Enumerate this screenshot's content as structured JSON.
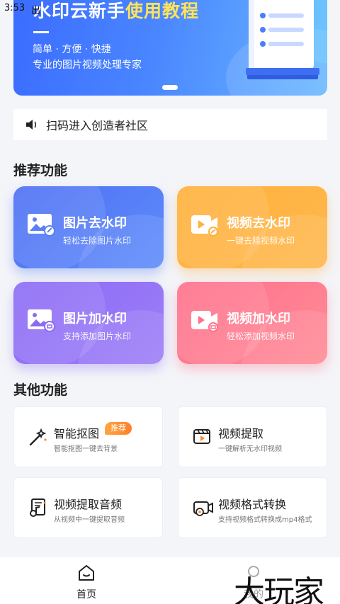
{
  "status_bar": {
    "time": "3:53",
    "extra": "出"
  },
  "banner": {
    "title_prefix": "水印云新手",
    "title_highlight": "使用教程",
    "subtitle1": "简单 · 方便 · 快捷",
    "subtitle2": "专业的图片视频处理专家"
  },
  "notice": {
    "text": "扫码进入创造者社区",
    "icon": "speaker-icon"
  },
  "recommended": {
    "title": "推荐功能",
    "items": [
      {
        "title": "图片去水印",
        "subtitle": "轻松去除图片水印",
        "icon": "image-remove-icon",
        "color": "#4d6ff3"
      },
      {
        "title": "视频去水印",
        "subtitle": "一键去除视频水印",
        "icon": "video-remove-icon",
        "color": "#ffb03a"
      },
      {
        "title": "图片加水印",
        "subtitle": "支持添加图片水印",
        "icon": "image-add-icon",
        "color": "#8b6af5"
      },
      {
        "title": "视频加水印",
        "subtitle": "轻松添加视频水印",
        "icon": "video-add-icon",
        "color": "#ff6f8b"
      }
    ]
  },
  "other": {
    "title": "其他功能",
    "items": [
      {
        "title": "智能抠图",
        "subtitle": "智能抠图一键去背景",
        "badge": "推荐",
        "icon": "magic-wand-icon"
      },
      {
        "title": "视频提取",
        "subtitle": "一键解析无水印视频",
        "icon": "video-clip-icon"
      },
      {
        "title": "视频提取音频",
        "subtitle": "从视频中一键提取音频",
        "icon": "music-file-icon"
      },
      {
        "title": "视频格式转换",
        "subtitle": "支持视频格式转换成mp4格式",
        "icon": "video-convert-icon"
      }
    ]
  },
  "bottom_nav": {
    "home_label": "首页",
    "mine_label": "我的"
  },
  "watermark": "大玩家"
}
